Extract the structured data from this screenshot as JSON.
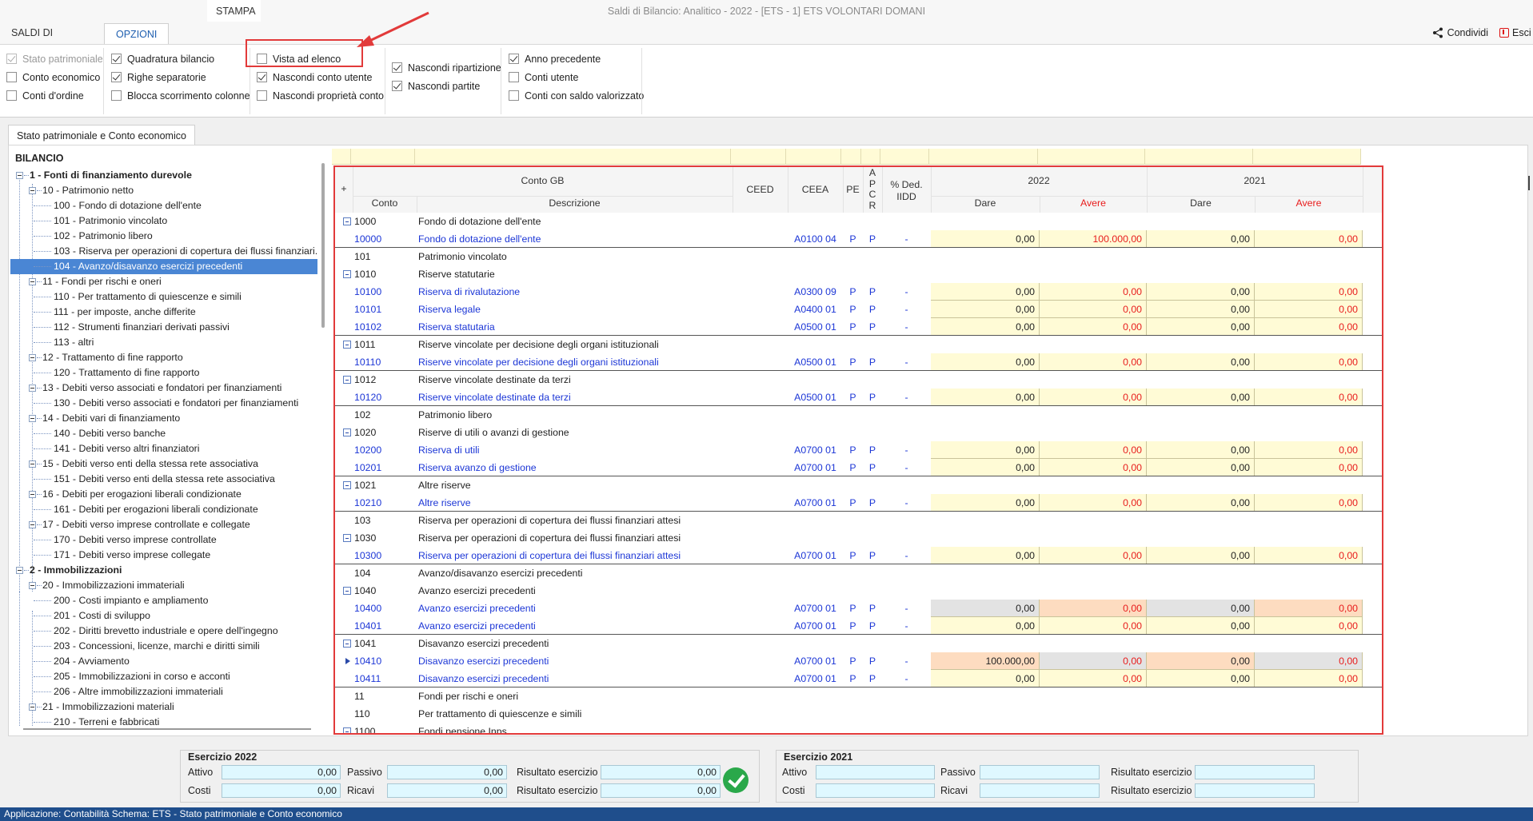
{
  "window": {
    "title": "Saldi di Bilancio: Analitico - 2022 - [ETS - 1] ETS VOLONTARI DOMANI"
  },
  "tabs": [
    {
      "label": "SALDI DI BILANCIO"
    },
    {
      "label": "OPZIONI"
    },
    {
      "label": "STAMPA"
    }
  ],
  "actions": {
    "share_label": "Condividi",
    "exit_label": "Esci"
  },
  "options": {
    "col1": [
      {
        "label": "Stato patrimoniale",
        "checked": true,
        "disabled": true
      },
      {
        "label": "Conto economico",
        "checked": false,
        "disabled": false
      },
      {
        "label": "Conti d'ordine",
        "checked": false,
        "disabled": false
      }
    ],
    "col2": [
      {
        "label": "Quadratura bilancio",
        "checked": true
      },
      {
        "label": "Righe separatorie",
        "checked": true
      },
      {
        "label": "Blocca scorrimento colonne",
        "checked": false
      }
    ],
    "col3": [
      {
        "label": "Vista ad elenco",
        "checked": false
      },
      {
        "label": "Nascondi conto utente",
        "checked": true
      },
      {
        "label": "Nascondi proprietà conto",
        "checked": false
      }
    ],
    "col4": [
      {
        "label": "Nascondi ripartizione",
        "checked": true
      },
      {
        "label": "Nascondi partite",
        "checked": true
      }
    ],
    "col5": [
      {
        "label": "Anno precedente",
        "checked": true
      },
      {
        "label": "Conti utente",
        "checked": false
      },
      {
        "label": "Conti con saldo valorizzato",
        "checked": false
      }
    ]
  },
  "main_tab": {
    "label": "Stato patrimoniale e Conto economico"
  },
  "tree": {
    "title": "BILANCIO",
    "nodes": [
      {
        "label": "1 - Fonti di finanziamento durevole",
        "level": 1
      },
      {
        "label": "10 - Patrimonio netto",
        "level": 2
      },
      {
        "label": "100 - Fondo di dotazione dell'ente",
        "level": 3
      },
      {
        "label": "101 - Patrimonio vincolato",
        "level": 3
      },
      {
        "label": "102 - Patrimonio libero",
        "level": 3
      },
      {
        "label": "103 - Riserva per operazioni di copertura dei flussi finanziari...",
        "level": 3
      },
      {
        "label": "104 - Avanzo/disavanzo esercizi precedenti",
        "level": 3,
        "selected": true
      },
      {
        "label": "11 - Fondi per rischi e oneri",
        "level": 2
      },
      {
        "label": "110 - Per trattamento di quiescenze e simili",
        "level": 3
      },
      {
        "label": "111 - per imposte, anche differite",
        "level": 3
      },
      {
        "label": "112 - Strumenti finanziari derivati passivi",
        "level": 3
      },
      {
        "label": "113 - altri",
        "level": 3
      },
      {
        "label": "12 - Trattamento di fine rapporto",
        "level": 2
      },
      {
        "label": "120 - Trattamento di fine rapporto",
        "level": 3
      },
      {
        "label": "13 - Debiti verso associati e fondatori per finanziamenti",
        "level": 2
      },
      {
        "label": "130 - Debiti verso associati e fondatori per finanziamenti",
        "level": 3
      },
      {
        "label": "14 - Debiti vari di finanziamento",
        "level": 2
      },
      {
        "label": "140 - Debiti verso banche",
        "level": 3
      },
      {
        "label": "141 - Debiti verso altri finanziatori",
        "level": 3
      },
      {
        "label": "15 - Debiti verso enti della stessa rete associativa",
        "level": 2
      },
      {
        "label": "151 - Debiti verso enti della stessa rete associativa",
        "level": 3
      },
      {
        "label": "16 - Debiti per erogazioni liberali condizionate",
        "level": 2
      },
      {
        "label": "161 - Debiti per erogazioni liberali condizionate",
        "level": 3
      },
      {
        "label": "17 - Debiti verso imprese controllate e collegate",
        "level": 2
      },
      {
        "label": "170 - Debiti verso imprese controllate",
        "level": 3
      },
      {
        "label": "171 - Debiti verso imprese collegate",
        "level": 3
      },
      {
        "label": "2 - Immobilizzazioni",
        "level": 1
      },
      {
        "label": "20 - Immobilizzazioni immateriali",
        "level": 2
      },
      {
        "label": "200 - Costi impianto e ampliamento",
        "level": 3
      },
      {
        "label": "201 - Costi di sviluppo",
        "level": 3
      },
      {
        "label": "202 - Diritti brevetto industriale e opere dell'ingegno",
        "level": 3
      },
      {
        "label": "203 - Concessioni, licenze, marchi e diritti simili",
        "level": 3
      },
      {
        "label": "204 - Avviamento",
        "level": 3
      },
      {
        "label": "205 - Immobilizzazioni in corso e acconti",
        "level": 3
      },
      {
        "label": "206 - Altre immobilizzazioni immateriali",
        "level": 3
      },
      {
        "label": "21 - Immobilizzazioni materiali",
        "level": 2
      },
      {
        "label": "210 - Terreni e fabbricati",
        "level": 3
      }
    ]
  },
  "grid": {
    "headers": {
      "plus": "+",
      "conto_gb": "Conto GB",
      "conto": "Conto",
      "descrizione": "Descrizione",
      "ceed": "CEED",
      "ceea": "CEEA",
      "pe": "PE",
      "apcr": [
        "A",
        "P",
        "C",
        "R"
      ],
      "ded_1": "% Ded.",
      "ded_2": "IIDD",
      "year1": "2022",
      "year2": "2021",
      "dare": "Dare",
      "avere": "Avere"
    },
    "rows": [
      {
        "type": "group",
        "expand": true,
        "conto": "1000",
        "desc": "Fondo di dotazione dell'ente"
      },
      {
        "type": "acc",
        "conto": "10000",
        "desc": "Fondo di dotazione dell'ente",
        "ceea": "A0100 04",
        "pe": "P",
        "apcr": "P",
        "ded": "-",
        "d1": "0,00",
        "a1": "100.000,00",
        "d2": "0,00",
        "a2": "0,00",
        "sep": true
      },
      {
        "type": "group",
        "expand": false,
        "conto": "101",
        "desc": "Patrimonio vincolato"
      },
      {
        "type": "group",
        "expand": true,
        "conto": "1010",
        "desc": "Riserve statutarie"
      },
      {
        "type": "acc",
        "conto": "10100",
        "desc": "Riserva di rivalutazione",
        "ceea": "A0300 09",
        "pe": "P",
        "apcr": "P",
        "ded": "-",
        "d1": "0,00",
        "a1": "0,00",
        "d2": "0,00",
        "a2": "0,00"
      },
      {
        "type": "acc",
        "conto": "10101",
        "desc": "Riserva legale",
        "ceea": "A0400 01",
        "pe": "P",
        "apcr": "P",
        "ded": "-",
        "d1": "0,00",
        "a1": "0,00",
        "d2": "0,00",
        "a2": "0,00"
      },
      {
        "type": "acc",
        "conto": "10102",
        "desc": "Riserva statutaria",
        "ceea": "A0500 01",
        "pe": "P",
        "apcr": "P",
        "ded": "-",
        "d1": "0,00",
        "a1": "0,00",
        "d2": "0,00",
        "a2": "0,00",
        "sep": true
      },
      {
        "type": "group",
        "expand": true,
        "conto": "1011",
        "desc": "Riserve vincolate per decisione degli organi istituzionali"
      },
      {
        "type": "acc",
        "conto": "10110",
        "desc": "Riserve vincolate per decisione degli organi istituzionali",
        "ceea": "A0500 01",
        "pe": "P",
        "apcr": "P",
        "ded": "-",
        "d1": "0,00",
        "a1": "0,00",
        "d2": "0,00",
        "a2": "0,00",
        "sep": true
      },
      {
        "type": "group",
        "expand": true,
        "conto": "1012",
        "desc": "Riserve vincolate destinate da terzi"
      },
      {
        "type": "acc",
        "conto": "10120",
        "desc": "Riserve vincolate destinate da terzi",
        "ceea": "A0500 01",
        "pe": "P",
        "apcr": "P",
        "ded": "-",
        "d1": "0,00",
        "a1": "0,00",
        "d2": "0,00",
        "a2": "0,00",
        "sep": true
      },
      {
        "type": "group",
        "expand": false,
        "conto": "102",
        "desc": "Patrimonio libero"
      },
      {
        "type": "group",
        "expand": true,
        "conto": "1020",
        "desc": "Riserve di utili o avanzi di gestione"
      },
      {
        "type": "acc",
        "conto": "10200",
        "desc": "Riserva di utili",
        "ceea": "A0700 01",
        "pe": "P",
        "apcr": "P",
        "ded": "-",
        "d1": "0,00",
        "a1": "0,00",
        "d2": "0,00",
        "a2": "0,00"
      },
      {
        "type": "acc",
        "conto": "10201",
        "desc": "Riserva avanzo di gestione",
        "ceea": "A0700 01",
        "pe": "P",
        "apcr": "P",
        "ded": "-",
        "d1": "0,00",
        "a1": "0,00",
        "d2": "0,00",
        "a2": "0,00",
        "sep": true
      },
      {
        "type": "group",
        "expand": true,
        "conto": "1021",
        "desc": "Altre riserve"
      },
      {
        "type": "acc",
        "conto": "10210",
        "desc": "Altre riserve",
        "ceea": "A0700 01",
        "pe": "P",
        "apcr": "P",
        "ded": "-",
        "d1": "0,00",
        "a1": "0,00",
        "d2": "0,00",
        "a2": "0,00",
        "sep": true
      },
      {
        "type": "group",
        "expand": false,
        "conto": "103",
        "desc": "Riserva per operazioni di copertura dei flussi finanziari attesi"
      },
      {
        "type": "group",
        "expand": true,
        "conto": "1030",
        "desc": "Riserva per operazioni di copertura dei flussi finanziari attesi"
      },
      {
        "type": "acc",
        "conto": "10300",
        "desc": "Riserva per operazioni di copertura dei flussi finanziari attesi",
        "ceea": "A0700 01",
        "pe": "P",
        "apcr": "P",
        "ded": "-",
        "d1": "0,00",
        "a1": "0,00",
        "d2": "0,00",
        "a2": "0,00",
        "sep": true
      },
      {
        "type": "group",
        "expand": false,
        "conto": "104",
        "desc": "Avanzo/disavanzo esercizi precedenti"
      },
      {
        "type": "group",
        "expand": true,
        "conto": "1040",
        "desc": "Avanzo esercizi precedenti"
      },
      {
        "type": "acc",
        "conto": "10400",
        "desc": "Avanzo esercizi precedenti",
        "ceea": "A0700 01",
        "pe": "P",
        "apcr": "P",
        "ded": "-",
        "d1": "0,00",
        "a1": "0,00",
        "d2": "0,00",
        "a2": "0,00",
        "shade": "grey-peach"
      },
      {
        "type": "acc",
        "conto": "10401",
        "desc": "Avanzo esercizi precedenti",
        "ceea": "A0700 01",
        "pe": "P",
        "apcr": "P",
        "ded": "-",
        "d1": "0,00",
        "a1": "0,00",
        "d2": "0,00",
        "a2": "0,00",
        "sep": true
      },
      {
        "type": "group",
        "expand": true,
        "conto": "1041",
        "desc": "Disavanzo esercizi precedenti"
      },
      {
        "type": "acc",
        "conto": "10410",
        "desc": "Disavanzo esercizi precedenti",
        "ceea": "A0700 01",
        "pe": "P",
        "apcr": "P",
        "ded": "-",
        "d1": "100.000,00",
        "a1": "0,00",
        "d2": "0,00",
        "a2": "0,00",
        "shade": "peach-grey",
        "current": true
      },
      {
        "type": "acc",
        "conto": "10411",
        "desc": "Disavanzo esercizi precedenti",
        "ceea": "A0700 01",
        "pe": "P",
        "apcr": "P",
        "ded": "-",
        "d1": "0,00",
        "a1": "0,00",
        "d2": "0,00",
        "a2": "0,00",
        "sep": true
      },
      {
        "type": "group",
        "expand": false,
        "conto": "11",
        "desc": "Fondi per rischi e oneri"
      },
      {
        "type": "group",
        "expand": false,
        "conto": "110",
        "desc": "Per trattamento di quiescenze e simili"
      },
      {
        "type": "group",
        "expand": true,
        "conto": "1100",
        "desc": "Fondi pensione Inps"
      }
    ]
  },
  "summary_2022": {
    "title": "Esercizio 2022",
    "attivo_label": "Attivo",
    "attivo": "0,00",
    "passivo_label": "Passivo",
    "passivo": "0,00",
    "risultato_label": "Risultato esercizio",
    "risultato": "0,00",
    "costi_label": "Costi",
    "costi": "0,00",
    "ricavi_label": "Ricavi",
    "ricavi": "0,00",
    "risultato2_label": "Risultato esercizio",
    "risultato2": "0,00"
  },
  "summary_2021": {
    "title": "Esercizio 2021",
    "attivo_label": "Attivo",
    "attivo": "",
    "passivo_label": "Passivo",
    "passivo": "",
    "risultato_label": "Risultato esercizio",
    "risultato": "",
    "costi_label": "Costi",
    "costi": "",
    "ricavi_label": "Ricavi",
    "ricavi": "",
    "risultato2_label": "Risultato esercizio",
    "risultato2": ""
  },
  "statusbar": {
    "text": "Applicazione: Contabilità   Schema: ETS - Stato patrimoniale e Conto economico"
  },
  "colors": {
    "accent": "#1f5fb0",
    "highlight": "#e23a3a",
    "status_bar": "#1f4e8c",
    "link": "#1c36d6",
    "negative": "#e81c1c"
  }
}
